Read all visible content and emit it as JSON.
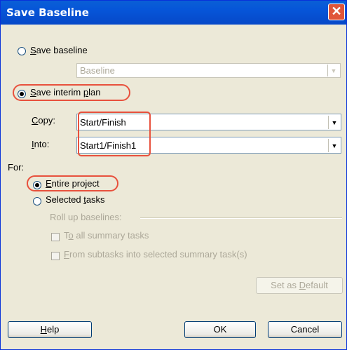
{
  "dialog": {
    "title": "Save Baseline",
    "close_icon": "close-icon",
    "accent_color": "#0a5fd6",
    "highlight_color": "#e8513d"
  },
  "save_baseline": {
    "label": "Save baseline",
    "selected": false,
    "dropdown_value": "Baseline"
  },
  "save_interim": {
    "label": "Save interim plan",
    "selected": true,
    "copy_label": "Copy:",
    "copy_value": "Start/Finish",
    "into_label": "Into:",
    "into_value": "Start1/Finish1"
  },
  "for_section": {
    "label": "For:",
    "entire_project": "Entire project",
    "entire_project_selected": true,
    "selected_tasks": "Selected tasks",
    "roll_up_label": "Roll up baselines:",
    "to_all_summary": "To all summary tasks",
    "from_subtasks": "From subtasks into selected summary task(s)"
  },
  "buttons": {
    "set_default": "Set as Default",
    "help": "Help",
    "ok": "OK",
    "cancel": "Cancel"
  }
}
